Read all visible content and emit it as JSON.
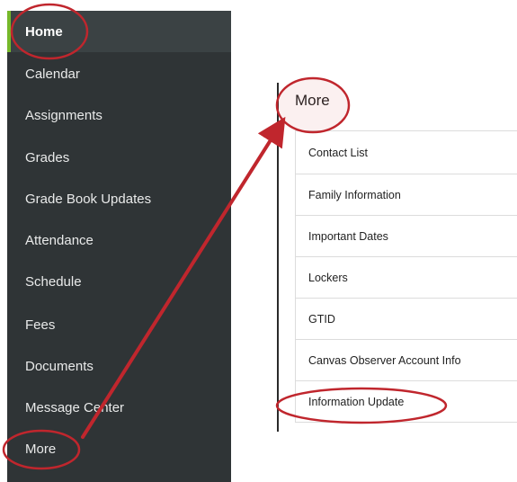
{
  "sidebar": {
    "items": [
      {
        "label": "Home",
        "active": true
      },
      {
        "label": "Calendar"
      },
      {
        "label": "Assignments"
      },
      {
        "label": "Grades"
      },
      {
        "label": "Grade Book Updates"
      },
      {
        "label": "Attendance"
      },
      {
        "label": "Schedule"
      },
      {
        "label": "Fees"
      },
      {
        "label": "Documents"
      },
      {
        "label": "Message Center"
      },
      {
        "label": "More"
      }
    ]
  },
  "more_panel": {
    "title": "More",
    "items": [
      {
        "label": "Contact List"
      },
      {
        "label": "Family Information"
      },
      {
        "label": "Important Dates"
      },
      {
        "label": "Lockers"
      },
      {
        "label": "GTID"
      },
      {
        "label": "Canvas Observer Account Info"
      },
      {
        "label": "Information Update"
      }
    ]
  },
  "colors": {
    "sidebar_bg": "#2f3436",
    "active_accent": "#76b82a",
    "annotation_red": "#c0262d"
  }
}
